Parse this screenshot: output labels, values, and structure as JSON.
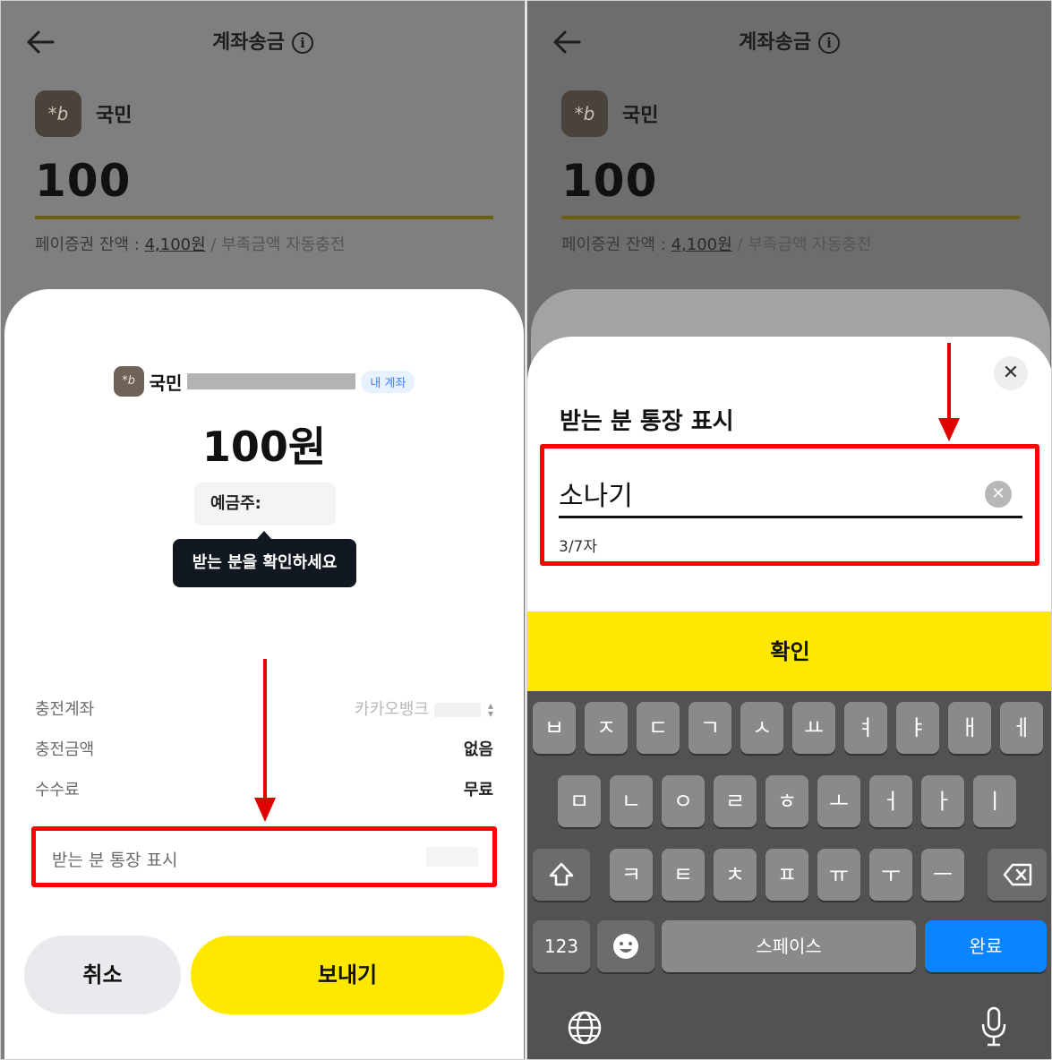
{
  "common": {
    "page_title": "계좌송금",
    "bank_name": "국민",
    "amount": "100",
    "balance_label": "페이증권 잔액 : ",
    "balance_value": "4,100원",
    "auto_charge": " / 부족금액 자동충전"
  },
  "left": {
    "sheet_bank": "국민",
    "my_account_badge": "내 계좌",
    "amount": "100원",
    "holder_label": "예금주:",
    "tooltip": "받는 분을 확인하세요",
    "details": [
      {
        "label": "충전계좌",
        "value": "카카오뱅크"
      },
      {
        "label": "충전금액",
        "value": "없음"
      },
      {
        "label": "수수료",
        "value": "무료"
      }
    ],
    "display_field_label": "받는 분 통장 표시",
    "cancel_button": "취소",
    "send_button": "보내기"
  },
  "right": {
    "sheet_title": "받는 분 통장 표시",
    "input_value": "소나기",
    "char_count": "3/7자",
    "confirm_button": "확인",
    "keyboard": {
      "row1": [
        "ㅂ",
        "ㅈ",
        "ㄷ",
        "ㄱ",
        "ㅅ",
        "ㅛ",
        "ㅕ",
        "ㅑ",
        "ㅐ",
        "ㅔ"
      ],
      "row2": [
        "ㅁ",
        "ㄴ",
        "ㅇ",
        "ㄹ",
        "ㅎ",
        "ㅗ",
        "ㅓ",
        "ㅏ",
        "ㅣ"
      ],
      "row3": [
        "ㅋ",
        "ㅌ",
        "ㅊ",
        "ㅍ",
        "ㅠ",
        "ㅜ",
        "ㅡ"
      ],
      "numbers_key": "123",
      "space_key": "스페이스",
      "done_key": "완료"
    }
  },
  "colors": {
    "accent_yellow": "#ffe800",
    "highlight_red": "#ff0000",
    "done_blue": "#0a84ff"
  }
}
